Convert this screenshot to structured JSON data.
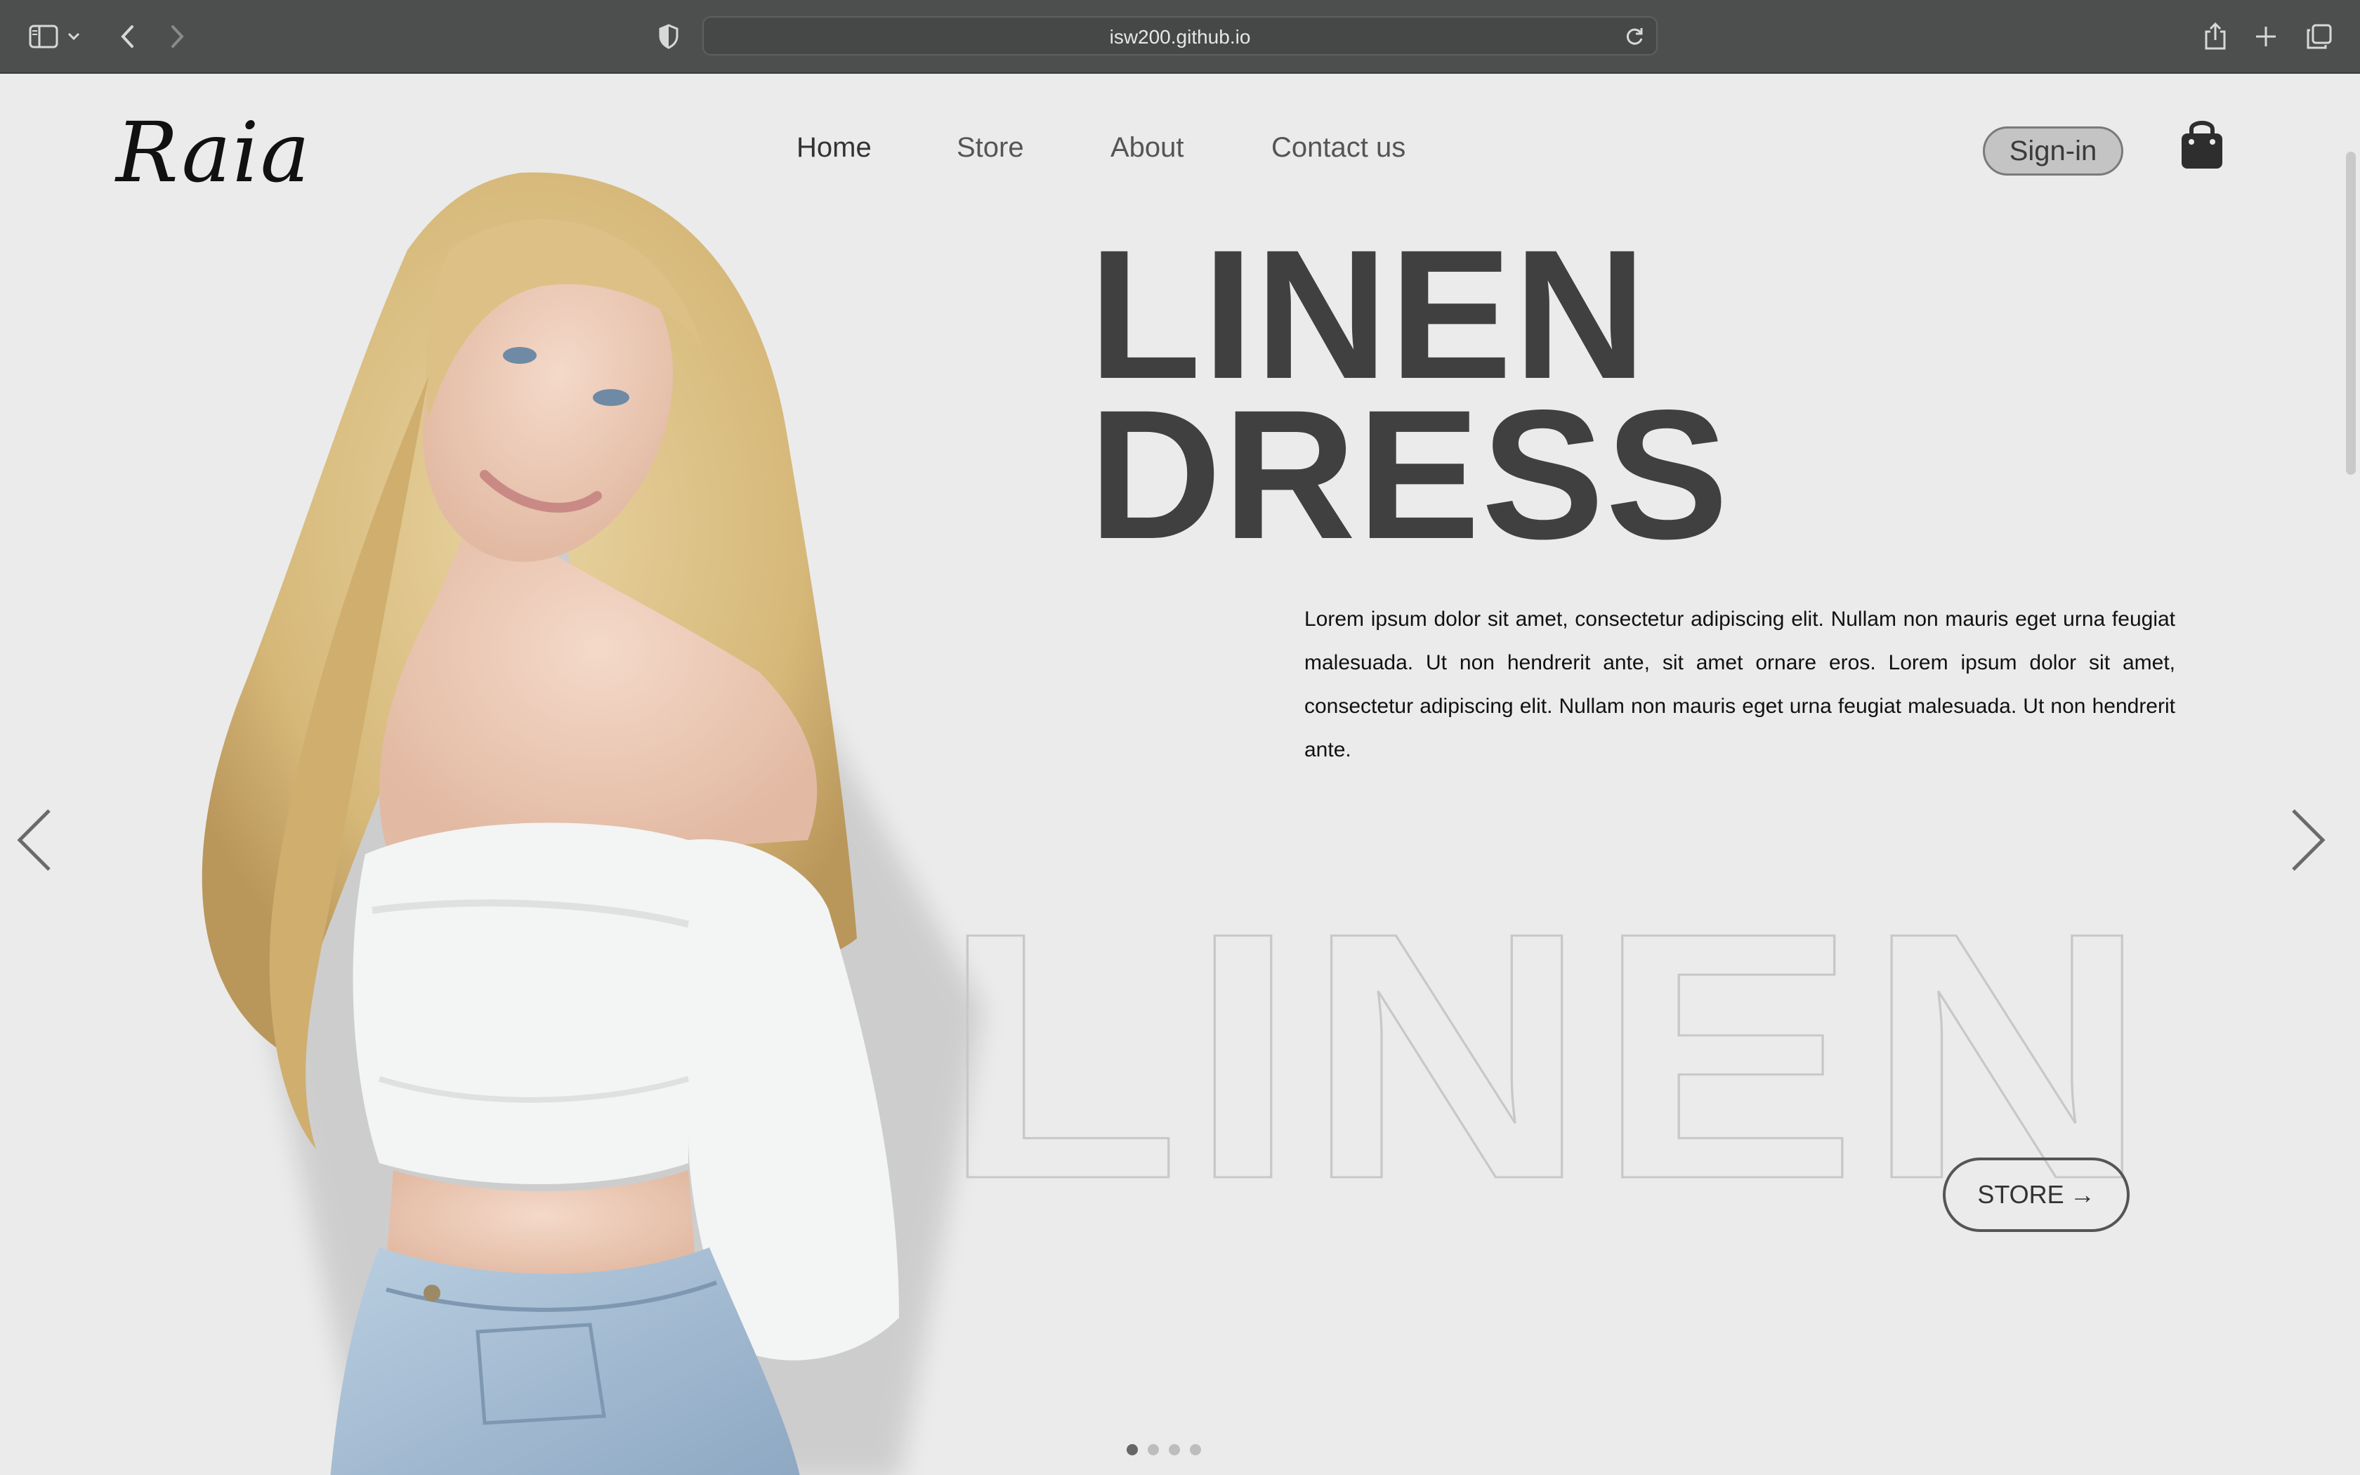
{
  "browser": {
    "url": "isw200.github.io",
    "icons": [
      "sidebar-icon",
      "chevron-down-icon",
      "back-icon",
      "forward-icon",
      "shield-icon",
      "reload-icon",
      "share-icon",
      "new-tab-icon",
      "tabs-overview-icon"
    ]
  },
  "site": {
    "logo": "Raia",
    "nav": {
      "home": "Home",
      "store": "Store",
      "about": "About",
      "contact": "Contact us"
    },
    "signin": "Sign-in",
    "cart_icon": "shopping-bag-icon"
  },
  "hero": {
    "title_line1": "LINEN",
    "title_line2": "DRESS",
    "description": "Lorem ipsum dolor sit amet, consectetur adipiscing elit. Nullam non mauris eget urna feugiat malesuada. Ut non hendrerit ante, sit amet ornare eros. Lorem ipsum dolor sit amet, consectetur adipiscing elit. Nullam non mauris eget urna feugiat malesuada. Ut non hendrerit ante.",
    "outline_word": "LINEN",
    "store_button": "STORE",
    "store_arrow": "→",
    "carousel": {
      "slides": 4,
      "active": 1
    }
  },
  "colors": {
    "page_bg": "#ebebeb",
    "title": "#404040",
    "signin_bg": "#c4c4c4",
    "chrome_bg": "#4d4f4e"
  }
}
